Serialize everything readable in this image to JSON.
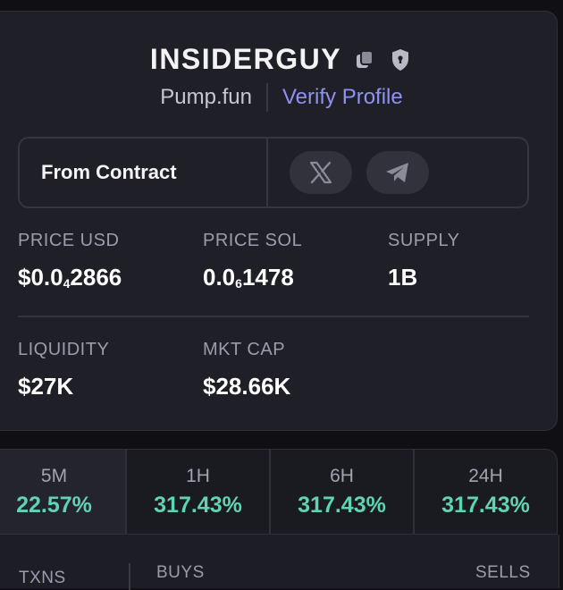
{
  "token": {
    "name": "INSIDERGUY",
    "platform": "Pump.fun",
    "verify_label": "Verify Profile",
    "icons": [
      "copy-icon",
      "shield-lock-icon"
    ]
  },
  "contract": {
    "label": "From Contract",
    "socials": [
      "x-icon",
      "telegram-icon"
    ]
  },
  "stats": {
    "price_usd": {
      "label": "PRICE USD",
      "prefix": "$0.0",
      "sub": "4",
      "suffix": "2866"
    },
    "price_sol": {
      "label": "PRICE SOL",
      "prefix": "0.0",
      "sub": "6",
      "suffix": "1478"
    },
    "supply": {
      "label": "SUPPLY",
      "value": "1B"
    },
    "liquidity": {
      "label": "LIQUIDITY",
      "value": "$27K"
    },
    "mkt_cap": {
      "label": "MKT CAP",
      "value": "$28.66K"
    }
  },
  "timeframes": [
    {
      "label": "5M",
      "value": "22.57%"
    },
    {
      "label": "1H",
      "value": "317.43%"
    },
    {
      "label": "6H",
      "value": "317.43%"
    },
    {
      "label": "24H",
      "value": "317.43%"
    }
  ],
  "txns": {
    "txns_label": "TXNS",
    "buys_label": "BUYS",
    "sells_label": "SELLS"
  },
  "colors": {
    "accent": "#8f92f0",
    "positive": "#5fd3b2",
    "card_bg": "#1f1f28"
  }
}
